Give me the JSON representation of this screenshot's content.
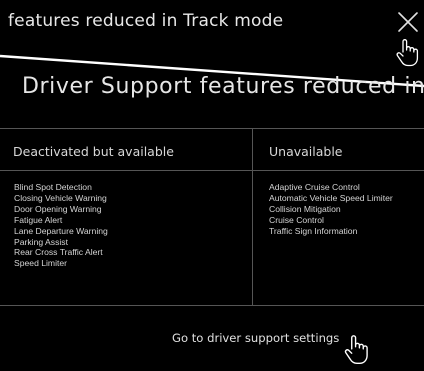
{
  "header": {
    "title": "features reduced in Track mode",
    "close_icon": "close-icon"
  },
  "dialog": {
    "title": "Driver Support features reduced in Track"
  },
  "table": {
    "left_header": "Deactivated but available",
    "right_header": "Unavailable",
    "left_items": [
      "Blind Spot Detection",
      "Closing Vehicle Warning",
      "Door Opening Warning",
      "Fatigue Alert",
      "Lane Departure Warning",
      "Parking Assist",
      "Rear Cross Traffic Alert",
      "Speed Limiter"
    ],
    "right_items": [
      "Adaptive Cruise Control",
      "Automatic Vehicle Speed Limiter",
      "Collision Mitigation",
      "Cruise Control",
      "Traffic Sign Information"
    ]
  },
  "footer": {
    "link_label": "Go to driver support settings"
  },
  "cursor_icon": "hand-pointer-icon",
  "colors": {
    "background": "#000000",
    "text": "#ffffff",
    "divider": "#555555"
  }
}
